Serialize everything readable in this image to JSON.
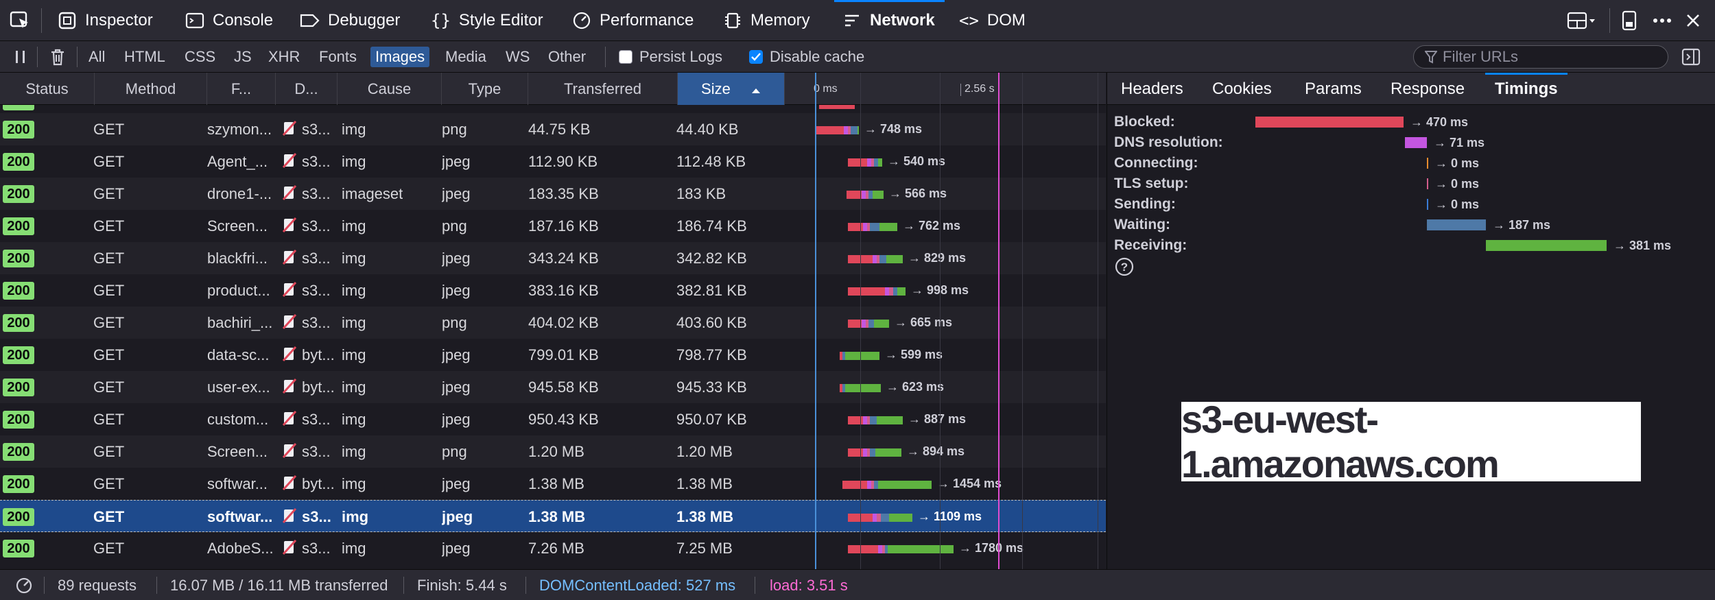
{
  "toolbar": {
    "tools": [
      {
        "label": "Inspector",
        "icon": "inspector-icon"
      },
      {
        "label": "Console",
        "icon": "console-icon"
      },
      {
        "label": "Debugger",
        "icon": "debugger-icon"
      },
      {
        "label": "Style Editor",
        "icon": "style-editor-icon"
      },
      {
        "label": "Performance",
        "icon": "performance-icon"
      },
      {
        "label": "Memory",
        "icon": "memory-icon"
      },
      {
        "label": "Network",
        "icon": "network-icon",
        "active": true
      },
      {
        "label": "DOM",
        "icon": "dom-icon"
      }
    ]
  },
  "filters": {
    "types": [
      "All",
      "HTML",
      "CSS",
      "JS",
      "XHR",
      "Fonts",
      "Images",
      "Media",
      "WS",
      "Other"
    ],
    "active_type": "Images",
    "persist_logs": "Persist Logs",
    "disable_cache": "Disable cache",
    "persist_checked": false,
    "disable_cache_checked": true,
    "search_placeholder": "Filter URLs"
  },
  "columns": [
    "Status",
    "Method",
    "F...",
    "D...",
    "Cause",
    "Type",
    "Transferred",
    "Size"
  ],
  "sorted_column": "Size",
  "waterfall": {
    "tick0": "0 ms",
    "tick1": "2.56 s"
  },
  "requests": [
    {
      "status": "200",
      "method": "GET",
      "file": "szymon...",
      "domain": "s3...",
      "cause": "img",
      "type": "png",
      "transferred": "44.75 KB",
      "size": "44.40 KB",
      "time": "→ 748 ms"
    },
    {
      "status": "200",
      "method": "GET",
      "file": "Agent_...",
      "domain": "s3...",
      "cause": "img",
      "type": "jpeg",
      "transferred": "112.90 KB",
      "size": "112.48 KB",
      "time": "→ 540 ms"
    },
    {
      "status": "200",
      "method": "GET",
      "file": "drone1-...",
      "domain": "s3...",
      "cause": "imageset",
      "type": "jpeg",
      "transferred": "183.35 KB",
      "size": "183 KB",
      "time": "→ 566 ms"
    },
    {
      "status": "200",
      "method": "GET",
      "file": "Screen...",
      "domain": "s3...",
      "cause": "img",
      "type": "png",
      "transferred": "187.16 KB",
      "size": "186.74 KB",
      "time": "→ 762 ms"
    },
    {
      "status": "200",
      "method": "GET",
      "file": "blackfri...",
      "domain": "s3...",
      "cause": "img",
      "type": "jpeg",
      "transferred": "343.24 KB",
      "size": "342.82 KB",
      "time": "→ 829 ms"
    },
    {
      "status": "200",
      "method": "GET",
      "file": "product...",
      "domain": "s3...",
      "cause": "img",
      "type": "jpeg",
      "transferred": "383.16 KB",
      "size": "382.81 KB",
      "time": "→ 998 ms"
    },
    {
      "status": "200",
      "method": "GET",
      "file": "bachiri_...",
      "domain": "s3...",
      "cause": "img",
      "type": "png",
      "transferred": "404.02 KB",
      "size": "403.60 KB",
      "time": "→ 665 ms"
    },
    {
      "status": "200",
      "method": "GET",
      "file": "data-sc...",
      "domain": "byt...",
      "cause": "img",
      "type": "jpeg",
      "transferred": "799.01 KB",
      "size": "798.77 KB",
      "time": "→ 599 ms"
    },
    {
      "status": "200",
      "method": "GET",
      "file": "user-ex...",
      "domain": "byt...",
      "cause": "img",
      "type": "jpeg",
      "transferred": "945.58 KB",
      "size": "945.33 KB",
      "time": "→ 623 ms"
    },
    {
      "status": "200",
      "method": "GET",
      "file": "custom...",
      "domain": "s3...",
      "cause": "img",
      "type": "jpeg",
      "transferred": "950.43 KB",
      "size": "950.07 KB",
      "time": "→ 887 ms"
    },
    {
      "status": "200",
      "method": "GET",
      "file": "Screen...",
      "domain": "s3...",
      "cause": "img",
      "type": "png",
      "transferred": "1.20 MB",
      "size": "1.20 MB",
      "time": "→ 894 ms"
    },
    {
      "status": "200",
      "method": "GET",
      "file": "softwar...",
      "domain": "byt...",
      "cause": "img",
      "type": "jpeg",
      "transferred": "1.38 MB",
      "size": "1.38 MB",
      "time": "→ 1454 ms"
    },
    {
      "status": "200",
      "method": "GET",
      "file": "softwar...",
      "domain": "s3...",
      "cause": "img",
      "type": "jpeg",
      "transferred": "1.38 MB",
      "size": "1.38 MB",
      "time": "→ 1109 ms",
      "selected": true
    },
    {
      "status": "200",
      "method": "GET",
      "file": "AdobeS...",
      "domain": "s3...",
      "cause": "img",
      "type": "jpeg",
      "transferred": "7.26 MB",
      "size": "7.25 MB",
      "time": "→ 1780 ms"
    }
  ],
  "sidepanel": {
    "tabs": [
      "Headers",
      "Cookies",
      "Params",
      "Response",
      "Timings"
    ],
    "active_tab": "Timings",
    "timings": [
      {
        "label": "Blocked:",
        "value": "→ 470 ms"
      },
      {
        "label": "DNS resolution:",
        "value": "→ 71 ms"
      },
      {
        "label": "Connecting:",
        "value": "→ 0 ms"
      },
      {
        "label": "TLS setup:",
        "value": "→ 0 ms"
      },
      {
        "label": "Sending:",
        "value": "→ 0 ms"
      },
      {
        "label": "Waiting:",
        "value": "→ 187 ms"
      },
      {
        "label": "Receiving:",
        "value": "→ 381 ms"
      }
    ],
    "domain_overlay": "s3-eu-west-1.amazonaws.com"
  },
  "statusbar": {
    "requests": "89 requests",
    "transferred": "16.07 MB / 16.11 MB transferred",
    "finish": "Finish: 5.44 s",
    "dcl": "DOMContentLoaded: 527 ms",
    "load": "load: 3.51 s"
  },
  "colors": {
    "blocked": "#e0475a",
    "dns": "#c456e0",
    "connect": "#e88c2f",
    "ssl": "#d45d8c",
    "send": "#3a7dd8",
    "wait": "#4e79a7",
    "receive": "#5fb340",
    "dcl_line": "#4a90d9",
    "load_line": "#e04bd0"
  }
}
